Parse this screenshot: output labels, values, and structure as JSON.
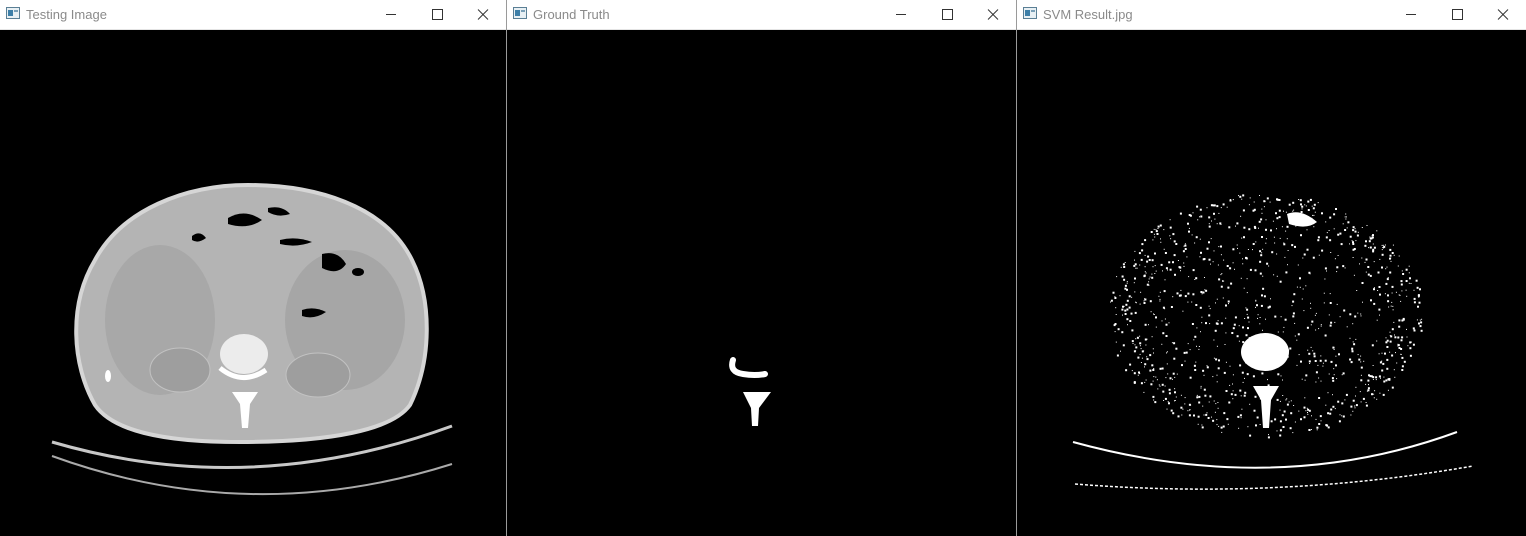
{
  "windows": [
    {
      "title": "Testing Image"
    },
    {
      "title": "Ground Truth"
    },
    {
      "title": "SVM Result.jpg"
    }
  ],
  "icons": {
    "app": "opencv-window-icon",
    "minimize": "minimize-icon",
    "maximize": "maximize-icon",
    "close": "close-icon"
  },
  "colors": {
    "titlebar_bg": "#ffffff",
    "title_text": "#8a8a8a",
    "canvas_bg": "#000000",
    "mask": "#ffffff"
  }
}
